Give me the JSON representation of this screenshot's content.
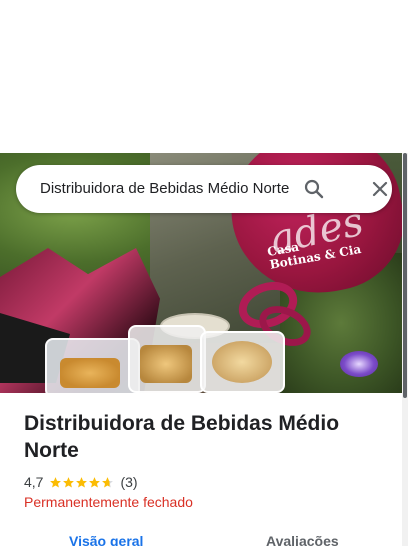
{
  "search": {
    "query": "Distribuidora de Bebidas Médio Norte",
    "search_icon": "search-icon",
    "close_icon": "close-icon"
  },
  "hero": {
    "balloon_text": "ades",
    "balloon_logo_line1": "Casa",
    "balloon_logo_line2": "Botinas & Cia"
  },
  "place": {
    "title": "Distribuidora de Bebidas Médio Norte",
    "rating": "4,7",
    "rating_stars_value": 4.7,
    "review_count": "(3)",
    "status": "Permanentemente fechado"
  },
  "tabs": [
    {
      "label": "Visão geral",
      "active": true
    },
    {
      "label": "Avaliações",
      "active": false
    }
  ],
  "colors": {
    "accent": "#1a73e8",
    "status_closed": "#d93025",
    "star": "#fbbc04"
  }
}
